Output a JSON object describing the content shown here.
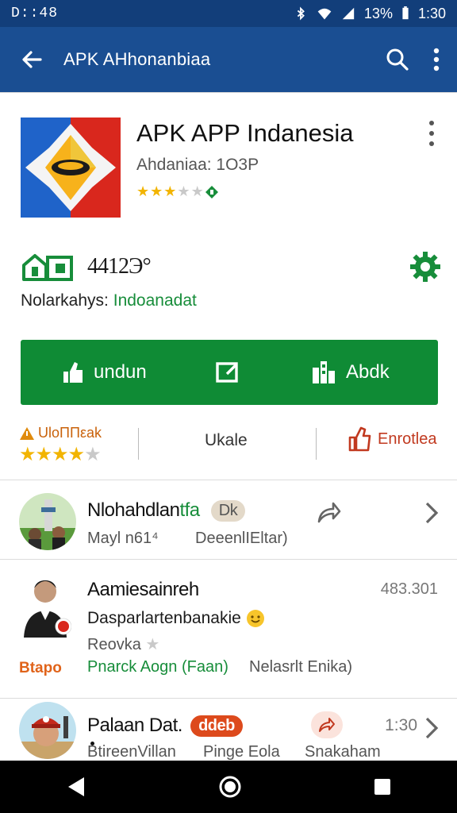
{
  "status_bar": {
    "time_left": "D::48",
    "battery_percent": "13%",
    "time_right": "1:30"
  },
  "app_bar": {
    "title": "APK AHhonanbiaa"
  },
  "app": {
    "name": "APK APP Indanesia",
    "subtitle": "Ahdaniaa: 1О3Р",
    "rating_stars": 3,
    "badge_icon": "leaf-badge-icon"
  },
  "info": {
    "value": "4412Э°",
    "language_label": "Nolarkahys:",
    "language_value": "Indoanadat"
  },
  "actions": {
    "download_label": "undun",
    "install_label": "Abdk"
  },
  "rating": {
    "label": "UloΠΠεak",
    "stars": 4,
    "middle_label": "Ukale",
    "right_label": "Enrotlea"
  },
  "list": [
    {
      "title": "Nlohahdlan",
      "title_suffix": "tfa",
      "pill": "Dk",
      "meta_left": "Mayl n61⁴",
      "meta_right": "DeeenlIEltar)"
    },
    {
      "title": "Aamiesainreh",
      "value_right": "483.301",
      "line2": "Dasparlartenbanakie",
      "line3": "Reovka",
      "tag_left": "Btapo",
      "line4_green": "Pnarck Aogn (Faan)",
      "line4_gray": "Nelasrlt Enika)"
    },
    {
      "title": "Palaan Dat.",
      "pill": "ddeb",
      "value_right": "1:30",
      "meta_1": "BtireenVillan",
      "meta_2": "Pinge Eola",
      "meta_3": "Snakaham"
    }
  ],
  "colors": {
    "status_bar": "#123e7a",
    "app_bar": "#1a4e92",
    "action_green": "#0f8b35",
    "accent_orange": "#c9620b",
    "accent_red": "#c1391f",
    "text_green": "#178d3a"
  }
}
